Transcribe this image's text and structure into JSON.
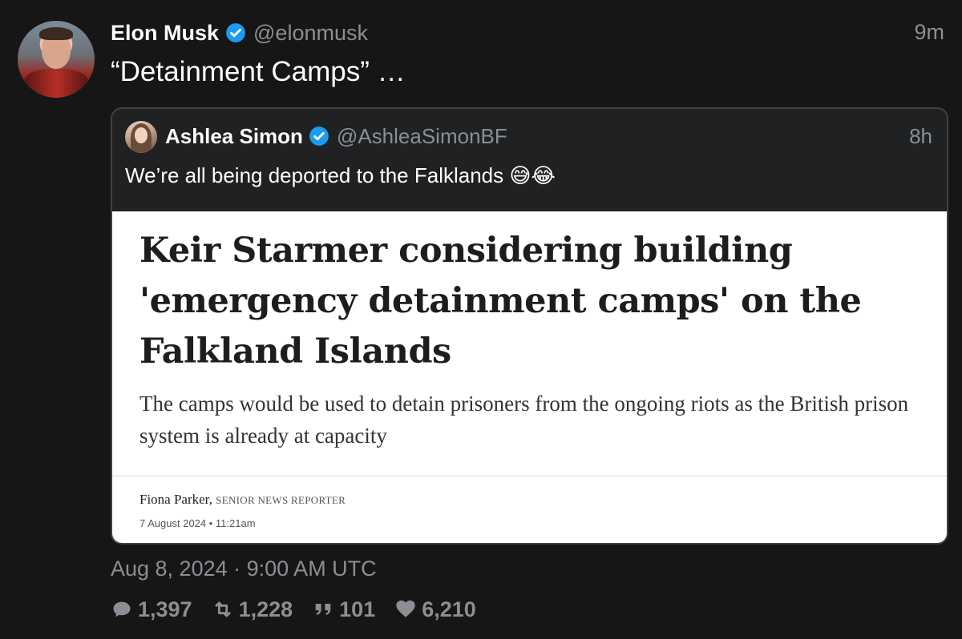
{
  "author": {
    "name": "Elon Musk",
    "handle": "@elonmusk",
    "time": "9m"
  },
  "tweet": {
    "text": "“Detainment Camps” …"
  },
  "quote": {
    "name": "Ashlea Simon",
    "handle": "@AshleaSimonBF",
    "time": "8h",
    "text": "We’re all being deported to the Falklands",
    "emojis": "😅😂",
    "article": {
      "headline": "Keir Starmer considering building 'emergency detainment camps' on the Falkland Islands",
      "subhead": "The camps would be used to detain prisoners from the ongoing riots as the British prison system is already at capacity",
      "author": "Fiona Parker,",
      "role": "SENIOR NEWS REPORTER",
      "date": "7 August 2024 • 11:21am"
    }
  },
  "timestamp": "Aug 8, 2024 · 9:00 AM UTC",
  "stats": {
    "replies": "1,397",
    "retweets": "1,228",
    "quotes": "101",
    "likes": "6,210"
  },
  "colors": {
    "background": "#161616",
    "verified": "#1d9bf0",
    "muted": "#8b8f94"
  }
}
